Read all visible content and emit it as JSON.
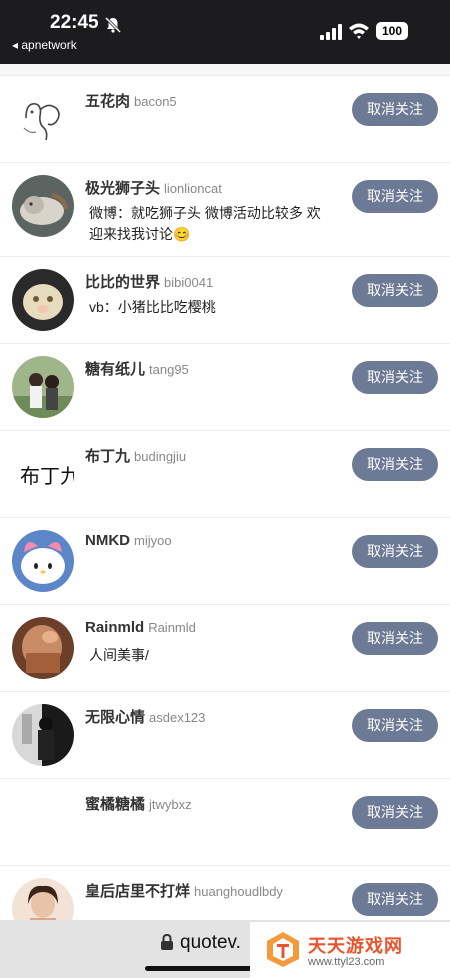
{
  "status_bar": {
    "time": "22:45",
    "back_label": "◂ apnetwork",
    "battery": "100"
  },
  "list": {
    "items": [
      {
        "name": "五花肉",
        "uid": "bacon5",
        "bio": [],
        "button": "取消关注",
        "avatar": "sketch"
      },
      {
        "name": "极光狮子头",
        "uid": "lionlioncat",
        "bio": [
          "微博：就吃狮子头 微博活动比较多 欢",
          "迎来找我讨论😊"
        ],
        "button": "取消关注",
        "avatar": "cat"
      },
      {
        "name": "比比的世界",
        "uid": "bibi0041",
        "bio": [
          "vb：小猪比比吃樱桃"
        ],
        "button": "取消关注",
        "avatar": "plush"
      },
      {
        "name": "糖有纸儿",
        "uid": "tang95",
        "bio": [],
        "button": "取消关注",
        "avatar": "couple"
      },
      {
        "name": "布丁九",
        "uid": "budingjiu",
        "bio": [],
        "button": "取消关注",
        "avatar": "calligraphy"
      },
      {
        "name": "NMKD",
        "uid": "mijyoo",
        "bio": [],
        "button": "取消关注",
        "avatar": "melody"
      },
      {
        "name": "Rainmld",
        "uid": "Rainmld",
        "bio": [
          "人间美事/"
        ],
        "button": "取消关注",
        "avatar": "warm"
      },
      {
        "name": "无限心情",
        "uid": "asdex123",
        "bio": [],
        "button": "取消关注",
        "avatar": "bw"
      },
      {
        "name": "蜜橘糖橘",
        "uid": "jtwybxz",
        "bio": [],
        "button": "取消关注",
        "avatar": "none"
      },
      {
        "name": "皇后店里不打烊",
        "uid": "huanghoudlbdy",
        "bio": [],
        "button": "取消关注",
        "avatar": "girl"
      }
    ]
  },
  "browser": {
    "url": "quotev."
  },
  "watermark": {
    "title": "天天游戏网",
    "url": "www.ttyl23.com"
  },
  "colors": {
    "button_bg": "#6d7a95",
    "status_bg": "#1c1c1e",
    "watermark_accent": "#e8542e"
  }
}
